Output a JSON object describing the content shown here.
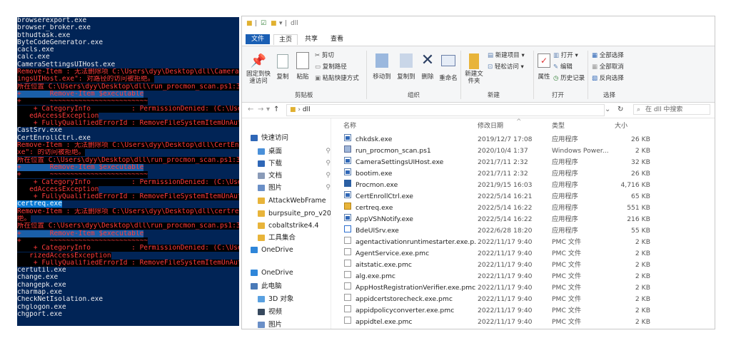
{
  "console": {
    "lines": [
      {
        "text": "browserexport.exe",
        "style": "w"
      },
      {
        "text": "browser_broker.exe",
        "style": "w"
      },
      {
        "text": "bthudtask.exe",
        "style": "w"
      },
      {
        "text": "ByteCodeGenerator.exe",
        "style": "w"
      },
      {
        "text": "cacls.exe",
        "style": "w"
      },
      {
        "text": "calc.exe",
        "style": "w"
      },
      {
        "text": "CameraSettingsUIHost.exe",
        "style": "w"
      },
      {
        "text": "Remove-Item : 无法删除项 C:\\Users\\dyy\\Desktop\\dll\\CameraSett",
        "style": "e"
      },
      {
        "text": "ingsUIHost.exe\": 对路径的访问被拒绝。",
        "style": "e"
      },
      {
        "text": "所在位置 C:\\Users\\dyy\\Desktop\\dll\\run_procmon_scan.ps1:38 字",
        "style": "e"
      },
      {
        "text": "+       Remove-Item $executable",
        "style": "errhl"
      },
      {
        "text": "+       ~~~~~~~~~~~~~~~~~~~~~~~~",
        "style": "e"
      },
      {
        "text": "    + CategoryInfo          : PermissionDenied: (C:\\Users\\dy",
        "style": "e"
      },
      {
        "text": "   edAccessException",
        "style": "e"
      },
      {
        "text": "    + FullyQualifiedErrorId : RemoveFileSystemItemUnAuthoriz",
        "style": "e"
      },
      {
        "text": "CastSrv.exe",
        "style": "w"
      },
      {
        "text": "CertEnrollCtrl.exe",
        "style": "w"
      },
      {
        "text": "Remove-Item : 无法删除项 C:\\Users\\dyy\\Desktop\\dll\\CertEnroll",
        "style": "e"
      },
      {
        "text": "xe\": 的访问被拒绝。",
        "style": "e"
      },
      {
        "text": "所在位置 C:\\Users\\dyy\\Desktop\\dll\\run_procmon_scan.ps1:38 字",
        "style": "e"
      },
      {
        "text": "+       Remove-Item $executable",
        "style": "errhl"
      },
      {
        "text": "+       ~~~~~~~~~~~~~~~~~~~~~~~~",
        "style": "e"
      },
      {
        "text": "    + CategoryInfo          : PermissionDenied: (C:\\Users\\dy",
        "style": "e"
      },
      {
        "text": "   edAccessException",
        "style": "e"
      },
      {
        "text": "    + FullyQualifiedErrorId : RemoveFileSystemItemUnAuthoriz",
        "style": "e"
      },
      {
        "text": "certreq.exe",
        "style": "hl"
      },
      {
        "text": "Remove-Item : 无法删除项 C:\\Users\\dyy\\Desktop\\dll\\certreq.ex",
        "style": "e"
      },
      {
        "text": "绝。",
        "style": "e"
      },
      {
        "text": "所在位置 C:\\Users\\dyy\\Desktop\\dll\\run_procmon_scan.ps1:38 字",
        "style": "e"
      },
      {
        "text": "+       Remove-Item $executable",
        "style": "errhl"
      },
      {
        "text": "+       ~~~~~~~~~~~~~~~~~~~~~~~~",
        "style": "e"
      },
      {
        "text": "    + CategoryInfo          : PermissionDenied: (C:\\Users\\dy",
        "style": "e"
      },
      {
        "text": "   rizedAccessException",
        "style": "e"
      },
      {
        "text": "    + FullyQualifiedErrorId : RemoveFileSystemItemUnAuthoriz",
        "style": "e"
      },
      {
        "text": "certutil.exe",
        "style": "w"
      },
      {
        "text": "change.exe",
        "style": "w"
      },
      {
        "text": "changepk.exe",
        "style": "w"
      },
      {
        "text": "charmap.exe",
        "style": "w"
      },
      {
        "text": "CheckNetIsolation.exe",
        "style": "w"
      },
      {
        "text": "chglogon.exe",
        "style": "w"
      },
      {
        "text": "chgport.exe",
        "style": "w"
      }
    ]
  },
  "explorer": {
    "title": "dll",
    "tabs": [
      "文件",
      "主页",
      "共享",
      "查看"
    ],
    "ribbon": {
      "clipboard": {
        "pin": "固定到快速访问",
        "copy": "复制",
        "paste": "粘贴",
        "cut": "剪切",
        "copy_path": "复制路径",
        "paste_shortcut": "粘贴快捷方式",
        "label": "剪贴板"
      },
      "organize": {
        "move_to": "移动到",
        "copy_to": "复制到",
        "delete": "删除",
        "rename": "重命名",
        "label": "组织"
      },
      "new": {
        "new_folder": "新建文件夹",
        "new_item": "新建项目",
        "easy_access": "轻松访问",
        "label": "新建"
      },
      "open": {
        "properties": "属性",
        "open": "打开",
        "edit": "编辑",
        "history": "历史记录",
        "label": "打开"
      },
      "select": {
        "select_all": "全部选择",
        "select_none": "全部取消",
        "invert": "反向选择",
        "label": "选择"
      }
    },
    "address": {
      "path": "dll",
      "search_placeholder": "在 dll 中搜索"
    },
    "nav": [
      {
        "label": "快速访问",
        "pin": false
      },
      {
        "label": "桌面",
        "pin": true
      },
      {
        "label": "下载",
        "pin": true
      },
      {
        "label": "文档",
        "pin": true
      },
      {
        "label": "图片",
        "pin": true
      },
      {
        "label": "AttackWebFrame",
        "pin": false
      },
      {
        "label": "burpsuite_pro_v20",
        "pin": false
      },
      {
        "label": "cobaltstrike4.4",
        "pin": false
      },
      {
        "label": "工具集合",
        "pin": false
      },
      {
        "label": "OneDrive",
        "pin": false
      },
      {
        "label": "OneDrive",
        "pin": false
      },
      {
        "label": "此电脑",
        "pin": false
      },
      {
        "label": "3D 对象",
        "pin": false
      },
      {
        "label": "视频",
        "pin": false
      },
      {
        "label": "图片",
        "pin": false
      }
    ],
    "columns": {
      "name": "名称",
      "date": "修改日期",
      "type": "类型",
      "size": "大小"
    },
    "files": [
      {
        "name": "chkdsk.exe",
        "date": "2019/12/7 17:08",
        "type": "应用程序",
        "size": "26 KB",
        "icon": "exe"
      },
      {
        "name": "run_procmon_scan.ps1",
        "date": "2020/10/4 1:37",
        "type": "Windows Power...",
        "size": "2 KB",
        "icon": "ps"
      },
      {
        "name": "CameraSettingsUIHost.exe",
        "date": "2021/7/11 2:32",
        "type": "应用程序",
        "size": "32 KB",
        "icon": "exe"
      },
      {
        "name": "bootim.exe",
        "date": "2021/7/11 2:32",
        "type": "应用程序",
        "size": "26 KB",
        "icon": "exe"
      },
      {
        "name": "Procmon.exe",
        "date": "2021/9/15 16:03",
        "type": "应用程序",
        "size": "4,716 KB",
        "icon": "proc"
      },
      {
        "name": "CertEnrollCtrl.exe",
        "date": "2022/5/14 16:21",
        "type": "应用程序",
        "size": "65 KB",
        "icon": "exe"
      },
      {
        "name": "certreq.exe",
        "date": "2022/5/14 16:22",
        "type": "应用程序",
        "size": "551 KB",
        "icon": "cert"
      },
      {
        "name": "AppVShNotify.exe",
        "date": "2022/5/14 16:22",
        "type": "应用程序",
        "size": "216 KB",
        "icon": "exe"
      },
      {
        "name": "BdeUISrv.exe",
        "date": "2022/6/28 18:20",
        "type": "应用程序",
        "size": "55 KB",
        "icon": "bde"
      },
      {
        "name": "agentactivationruntimestarter.exe.p...",
        "date": "2022/11/17 9:40",
        "type": "PMC 文件",
        "size": "2 KB",
        "icon": "pmc"
      },
      {
        "name": "AgentService.exe.pmc",
        "date": "2022/11/17 9:40",
        "type": "PMC 文件",
        "size": "2 KB",
        "icon": "pmc"
      },
      {
        "name": "aitstatic.exe.pmc",
        "date": "2022/11/17 9:40",
        "type": "PMC 文件",
        "size": "2 KB",
        "icon": "pmc"
      },
      {
        "name": "alg.exe.pmc",
        "date": "2022/11/17 9:40",
        "type": "PMC 文件",
        "size": "2 KB",
        "icon": "pmc"
      },
      {
        "name": "AppHostRegistrationVerifier.exe.pmc",
        "date": "2022/11/17 9:40",
        "type": "PMC 文件",
        "size": "2 KB",
        "icon": "pmc"
      },
      {
        "name": "appidcertstorecheck.exe.pmc",
        "date": "2022/11/17 9:40",
        "type": "PMC 文件",
        "size": "2 KB",
        "icon": "pmc"
      },
      {
        "name": "appidpolicyconverter.exe.pmc",
        "date": "2022/11/17 9:40",
        "type": "PMC 文件",
        "size": "2 KB",
        "icon": "pmc"
      },
      {
        "name": "appidtel.exe.pmc",
        "date": "2022/11/17 9:40",
        "type": "PMC 文件",
        "size": "2 KB",
        "icon": "pmc"
      }
    ]
  },
  "colors": {
    "console_bg": "#012456",
    "error": "#ff3b3b",
    "accent": "#1a5fb4"
  }
}
